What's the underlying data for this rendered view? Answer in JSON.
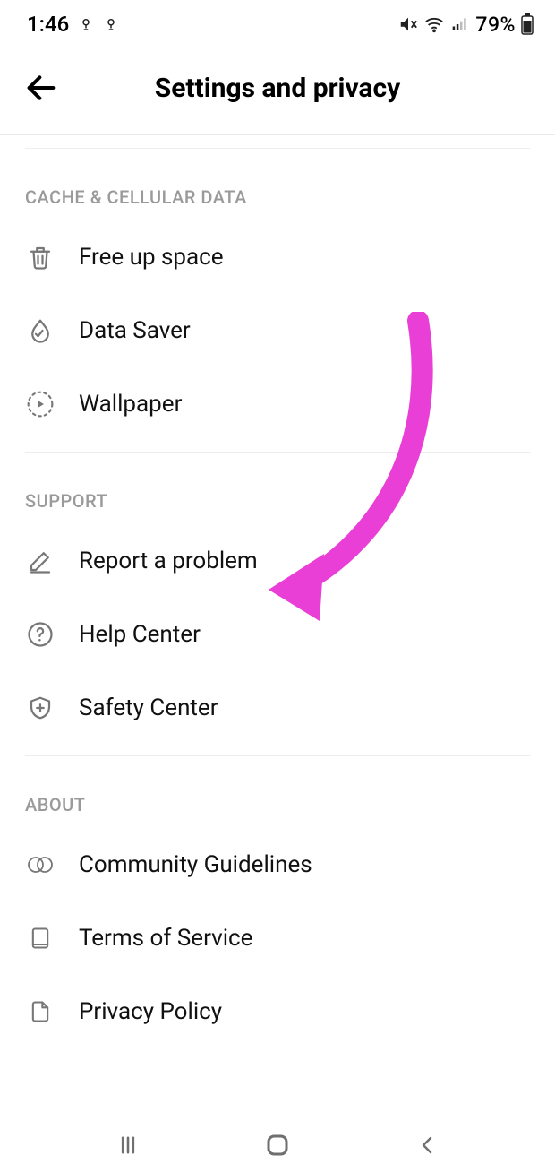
{
  "status": {
    "time": "1:46",
    "battery_percent": "79%"
  },
  "header": {
    "title": "Settings and privacy"
  },
  "sections": {
    "cache": {
      "header": "CACHE & CELLULAR DATA",
      "items": {
        "free_up": "Free up space",
        "data_saver": "Data Saver",
        "wallpaper": "Wallpaper"
      }
    },
    "support": {
      "header": "SUPPORT",
      "items": {
        "report": "Report a problem",
        "help": "Help Center",
        "safety": "Safety Center"
      }
    },
    "about": {
      "header": "ABOUT",
      "items": {
        "community": "Community Guidelines",
        "terms": "Terms of Service",
        "privacy": "Privacy Policy"
      }
    }
  },
  "annotation": {
    "arrow_color": "#e93fd6"
  }
}
